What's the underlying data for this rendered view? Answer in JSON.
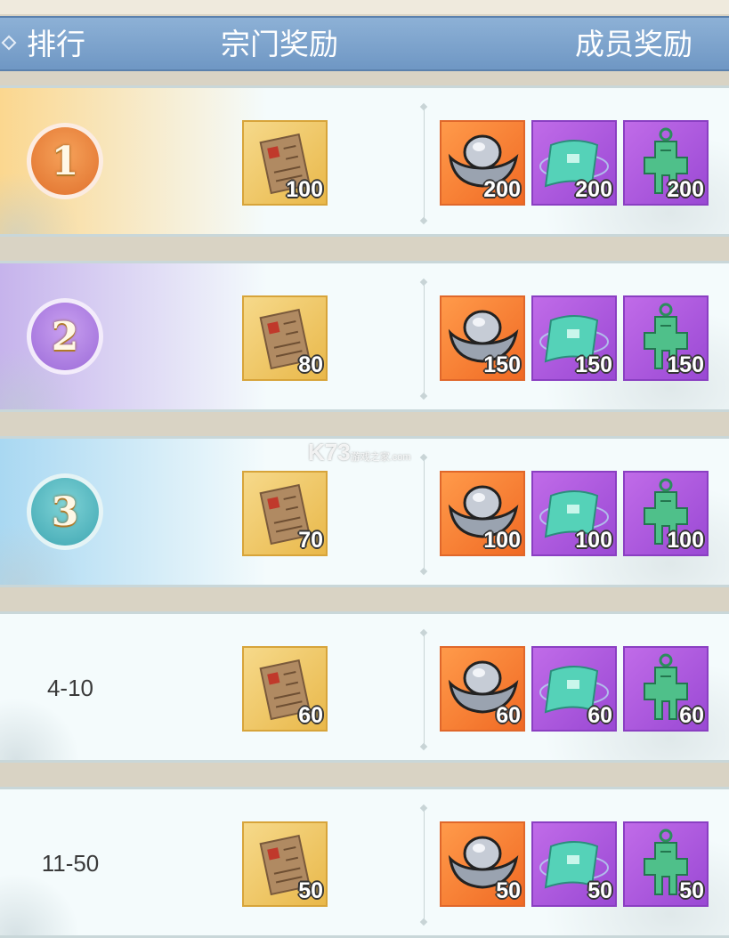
{
  "header": {
    "rank_label": "排行",
    "sect_reward_label": "宗门奖励",
    "member_reward_label": "成员奖励"
  },
  "watermark": {
    "logo": "K73",
    "sub": "游戏之家",
    "domain": ".com"
  },
  "colors": {
    "header_bg": "#7aa2cc",
    "rank1_tint": "#fbd78f",
    "rank2_tint": "#c6b3ec",
    "rank3_tint": "#a9d8f2",
    "sect_item_bg": "#f0c865",
    "silver_item_bg": "#f58236",
    "scroll_item_bg": "#ad5bde",
    "jade_item_bg": "#ad5bde"
  },
  "rows": [
    {
      "rank_display": "1",
      "rank_text": "",
      "sect_reward": {
        "icon": "sect-letter-icon",
        "qty": "100"
      },
      "member_rewards": [
        {
          "icon": "silver-ingot-icon",
          "qty": "200"
        },
        {
          "icon": "jade-scroll-icon",
          "qty": "200"
        },
        {
          "icon": "jade-token-icon",
          "qty": "200"
        }
      ]
    },
    {
      "rank_display": "2",
      "rank_text": "",
      "sect_reward": {
        "icon": "sect-letter-icon",
        "qty": "80"
      },
      "member_rewards": [
        {
          "icon": "silver-ingot-icon",
          "qty": "150"
        },
        {
          "icon": "jade-scroll-icon",
          "qty": "150"
        },
        {
          "icon": "jade-token-icon",
          "qty": "150"
        }
      ]
    },
    {
      "rank_display": "3",
      "rank_text": "",
      "sect_reward": {
        "icon": "sect-letter-icon",
        "qty": "70"
      },
      "member_rewards": [
        {
          "icon": "silver-ingot-icon",
          "qty": "100"
        },
        {
          "icon": "jade-scroll-icon",
          "qty": "100"
        },
        {
          "icon": "jade-token-icon",
          "qty": "100"
        }
      ]
    },
    {
      "rank_display": "",
      "rank_text": "4-10",
      "sect_reward": {
        "icon": "sect-letter-icon",
        "qty": "60"
      },
      "member_rewards": [
        {
          "icon": "silver-ingot-icon",
          "qty": "60"
        },
        {
          "icon": "jade-scroll-icon",
          "qty": "60"
        },
        {
          "icon": "jade-token-icon",
          "qty": "60"
        }
      ]
    },
    {
      "rank_display": "",
      "rank_text": "11-50",
      "sect_reward": {
        "icon": "sect-letter-icon",
        "qty": "50"
      },
      "member_rewards": [
        {
          "icon": "silver-ingot-icon",
          "qty": "50"
        },
        {
          "icon": "jade-scroll-icon",
          "qty": "50"
        },
        {
          "icon": "jade-token-icon",
          "qty": "50"
        }
      ]
    }
  ]
}
